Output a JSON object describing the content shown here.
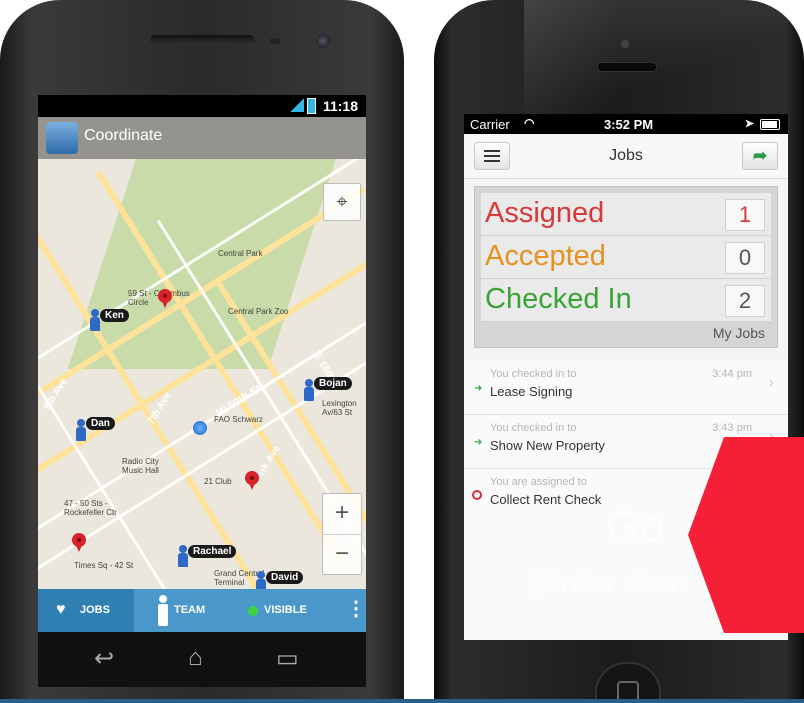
{
  "android": {
    "status_time": "11:18",
    "app_title": "Coordinate",
    "map_labels": {
      "central_park": "Central Park",
      "central_park_zoo": "Central Park Zoo",
      "w59": "W 59th St",
      "e65": "E 65th St",
      "ave7": "7th Ave",
      "ave9": "9th Ave",
      "park_ave": "Park Ave",
      "columbus": "59 St - Columbus Circle",
      "times_sq": "Times Sq - 42 St",
      "radio_city": "Radio City Music Hall",
      "rockefeller": "47 - 50 Sts - Rockefeller Ctr",
      "grand_central": "Grand Central Terminal",
      "fao": "FAO Schwarz",
      "club21": "21 Club",
      "lexington": "Lexington Av/63 St"
    },
    "people": [
      "Ken",
      "Bojan",
      "Dan",
      "Rachael",
      "David"
    ],
    "zoom_in": "+",
    "zoom_out": "−",
    "tabs": {
      "jobs": "JOBS",
      "team": "TEAM",
      "visible": "VISIBLE"
    },
    "nav_icons": [
      "back-icon",
      "home-icon",
      "recents-icon"
    ]
  },
  "iphone": {
    "carrier": "Carrier",
    "status_time": "3:52 PM",
    "nav_title": "Jobs",
    "summary": [
      {
        "label": "Assigned",
        "count": "1",
        "color": "#d9383a"
      },
      {
        "label": "Accepted",
        "count": "0",
        "color": "#e3921e"
      },
      {
        "label": "Checked In",
        "count": "2",
        "color": "#3aa335"
      }
    ],
    "my_jobs": "My Jobs",
    "activity": [
      {
        "sub": "You checked in to",
        "main": "Lease Signing",
        "time": "3:44 pm",
        "type": "checkin"
      },
      {
        "sub": "You checked in to",
        "main": "Show New Property",
        "time": "3:43 pm",
        "type": "checkin"
      },
      {
        "sub": "You are assigned to",
        "main": "Collect Rent Check",
        "time": "3:",
        "type": "assigned"
      }
    ],
    "overlay_go": "Go",
    "overlay_enter": "[Enter dem"
  }
}
